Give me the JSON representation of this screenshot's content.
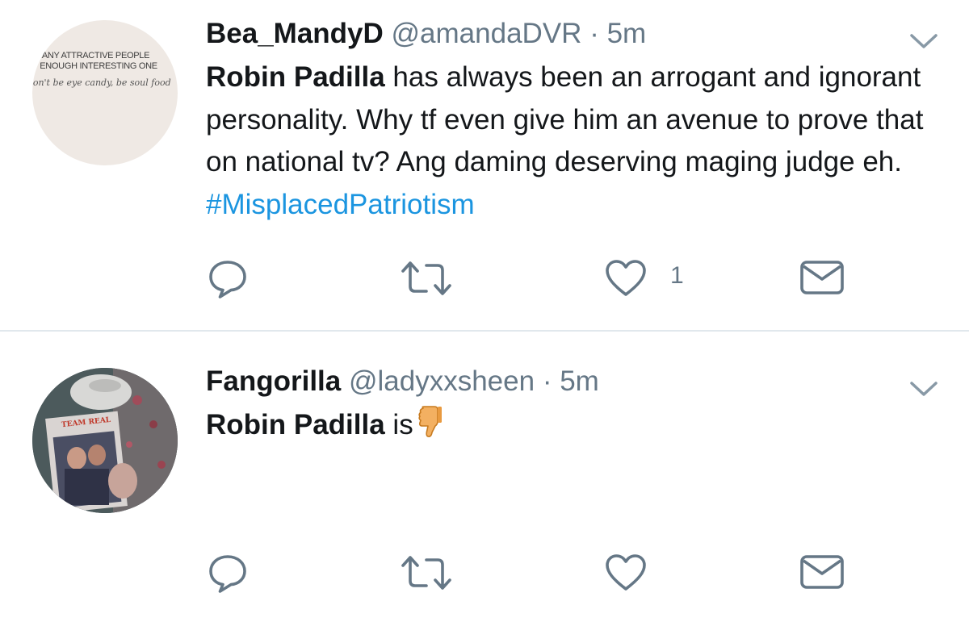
{
  "tweets": [
    {
      "display_name": "Bea_MandyD",
      "handle": "@amandaDVR",
      "separator": "·",
      "time": "5m",
      "avatar_text": [
        "O MANY ATTRACTIVE PEOPLE",
        "OT ENOUGH INTERESTING ONE",
        "Don't be eye candy, be soul food"
      ],
      "body": {
        "bold": "Robin Padilla",
        "text": " has always been an arrogant and ignorant personality. Why tf even give him an avenue to prove that on national tv? Ang daming deserving maging judge eh. ",
        "hashtag": "#MisplacedPatriotism"
      },
      "likes": "1"
    },
    {
      "display_name": "Fangorilla",
      "handle": "@ladyxxsheen",
      "separator": "·",
      "time": "5m",
      "avatar_text": [
        "TEAM REAL"
      ],
      "body": {
        "bold": "Robin Padilla",
        "text": " is",
        "emoji": "thumbs-down"
      },
      "likes": ""
    }
  ],
  "colors": {
    "text": "#14171a",
    "secondary": "#657786",
    "hashtag": "#1b95e0",
    "icon": "#657786",
    "divider": "#e1e8ed"
  },
  "icons": [
    "chevron-down-icon",
    "reply-icon",
    "retweet-icon",
    "like-icon",
    "direct-message-icon",
    "thumbs-down-emoji"
  ]
}
